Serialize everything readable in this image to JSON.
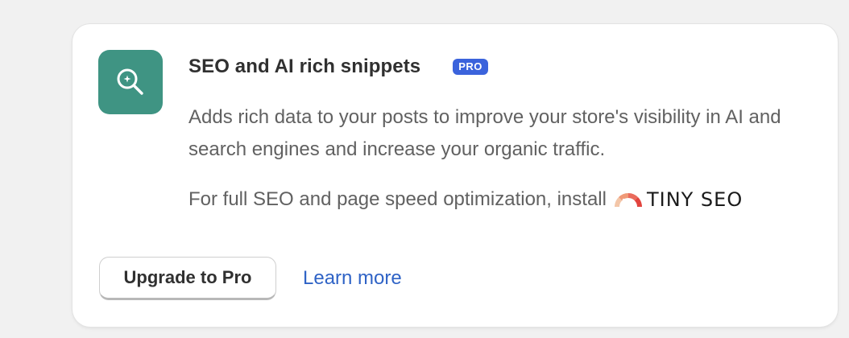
{
  "card": {
    "title": "SEO and AI rich snippets",
    "badge": "PRO",
    "description": "Adds rich data to your posts to improve your store's visibility in AI and search engines and increase your organic traffic.",
    "install_text": "For full SEO and page speed optimization, install",
    "install_logo_text": "TINY SEO",
    "upgrade_button": "Upgrade to Pro",
    "learn_more_link": "Learn more"
  },
  "icons": {
    "app_icon": "search-icon",
    "logo_icon": "gauge-icon"
  },
  "colors": {
    "app_icon_bg": "#3f9483",
    "badge_bg": "#3b63dc",
    "link": "#2f63c6",
    "text_primary": "#303030",
    "text_secondary": "#616161"
  }
}
